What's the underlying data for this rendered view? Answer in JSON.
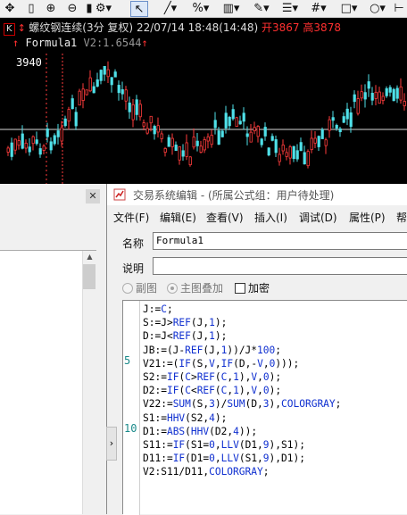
{
  "toolbar": {
    "icons": [
      "move-icon",
      "ruler-icon",
      "zoom-in-icon",
      "zoom-out-icon",
      "fit-icon",
      "settings-icon",
      "cursor-icon",
      "line-tool-icon",
      "percent-tool-icon",
      "grid-tool-icon",
      "pen-tool-icon",
      "list-tool-icon",
      "hash-tool-icon",
      "rect-tool-icon",
      "circle-tool-icon"
    ]
  },
  "chart": {
    "k_label": "K",
    "instrument": "螺纹钢连续(3分 复权)",
    "datetime": "22/07/14 18:48(14:48)",
    "open_label": "开",
    "open_value": "3867",
    "high_label": "高",
    "high_value": "3878",
    "formula_name": "Formula1",
    "formula_value": "V2:1.6544",
    "price_label": "3940",
    "colors": {
      "up": "#ff3b3b",
      "down": "#4fe0e8",
      "background": "#000000"
    }
  },
  "dialog": {
    "title": "交易系统编辑 - (所属公式组：用户待处理)",
    "menus": [
      "文件(F)",
      "编辑(E)",
      "查看(V)",
      "插入(I)",
      "调试(D)",
      "属性(P)",
      "帮"
    ],
    "name_label": "名称",
    "name_value": "Formula1",
    "desc_label": "说明",
    "desc_value": "",
    "opt_sub": "副图",
    "opt_main": "主图叠加",
    "opt_encrypt": "加密",
    "line_numbers": [
      "5",
      "10"
    ],
    "code": [
      "J:=C;",
      "S:=J>REF(J,1);",
      "D:=J<REF(J,1);",
      "JB:=(J-REF(J,1))/J*100;",
      "V21:=(IF(S,V,IF(D,-V,0)));",
      "S2:=IF(C>REF(C,1),V,0);",
      "D2:=IF(C<REF(C,1),V,0);",
      "V22:=SUM(S,3)/SUM(D,3),COLORGRAY;",
      "S1:=HHV(S2,4);",
      "D1:=ABS(HHV(D2,4));",
      "S11:=IF(S1=0,LLV(D1,9),S1);",
      "D11:=IF(D1=0,LLV(S1,9),D1);",
      "V2:S11/D11,COLORGRAY;"
    ]
  }
}
